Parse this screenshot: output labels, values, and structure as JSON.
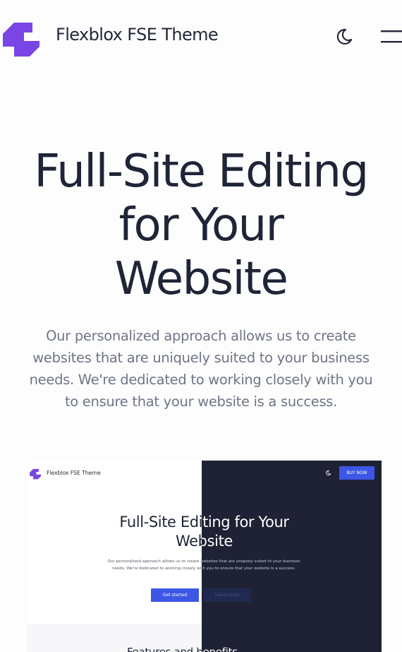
{
  "header": {
    "site_title": "Flexblox FSE Theme",
    "logo_icon": "flexblox-logo-icon",
    "theme_toggle_icon": "moon-icon",
    "menu_icon": "hamburger-menu-icon"
  },
  "hero": {
    "title_lines": [
      "Full-Site Editing",
      "for Your",
      "Website"
    ],
    "description": "Our personalized approach allows us to create websites that are uniquely suited to your business needs. We're dedicated to working closely with you to ensure that your website is a success."
  },
  "preview": {
    "site_title": "Flexblox FSE Theme",
    "buy_label": "BUY NOW",
    "title_lines": [
      "Full-Site Editing for Your",
      "Website"
    ],
    "description": "Our personalized approach allows us to create websites that are uniquely suited to your business needs. We're dedicated to working closely with you to ensure that your website is a success.",
    "get_started_label": "Get started",
    "learn_more_label": "Learn more",
    "features_heading": "Features and benefits"
  },
  "colors": {
    "brand_purple": "#7a45e6",
    "accent_blue": "#3d56e6",
    "dark_bg": "#1e2234",
    "heading": "#1f2537",
    "body_text": "#6f7587"
  }
}
